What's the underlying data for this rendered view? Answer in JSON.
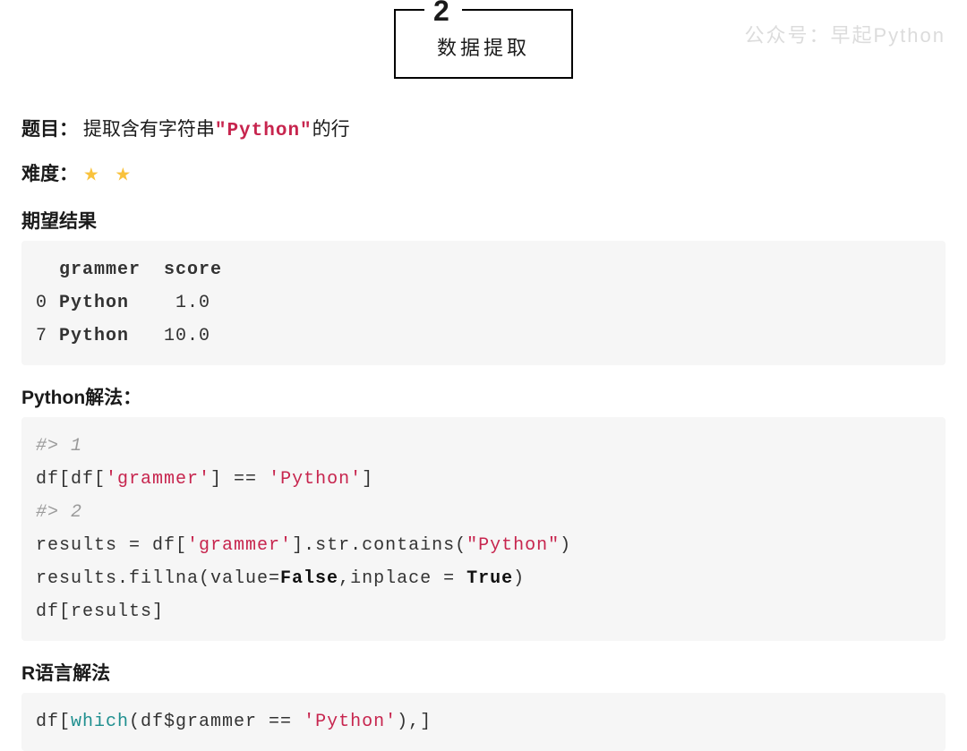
{
  "watermark": "公众号：早起Python",
  "section": {
    "number": "2",
    "title": "数据提取"
  },
  "question": {
    "label": "题目：",
    "text_before": "提取含有字符串",
    "code": "\"Python\"",
    "text_after": "的行"
  },
  "difficulty": {
    "label": "难度：",
    "stars": "★ ★"
  },
  "expected": {
    "heading": "期望结果",
    "header_line": "  grammer  score",
    "rows": [
      "0 Python    1.0",
      "7 Python   10.0"
    ]
  },
  "python_solution": {
    "heading": "Python解法：",
    "c1": "#> 1",
    "l2_a": "df[df[",
    "l2_s": "'grammer'",
    "l2_b": "] == ",
    "l2_s2": "'Python'",
    "l2_c": "]",
    "c2": "#> 2",
    "l4_a": "results = df[",
    "l4_s": "'grammer'",
    "l4_b": "].str.contains(",
    "l4_s2": "\"Python\"",
    "l4_c": ")",
    "l5_a": "results.fillna(value=",
    "l5_bool1": "False",
    "l5_b": ",inplace = ",
    "l5_bool2": "True",
    "l5_c": ")",
    "l6": "df[results]"
  },
  "r_solution": {
    "heading": "R语言解法",
    "a": "df[",
    "fn": "which",
    "b": "(df$grammer == ",
    "s": "'Python'",
    "c": "),]"
  }
}
